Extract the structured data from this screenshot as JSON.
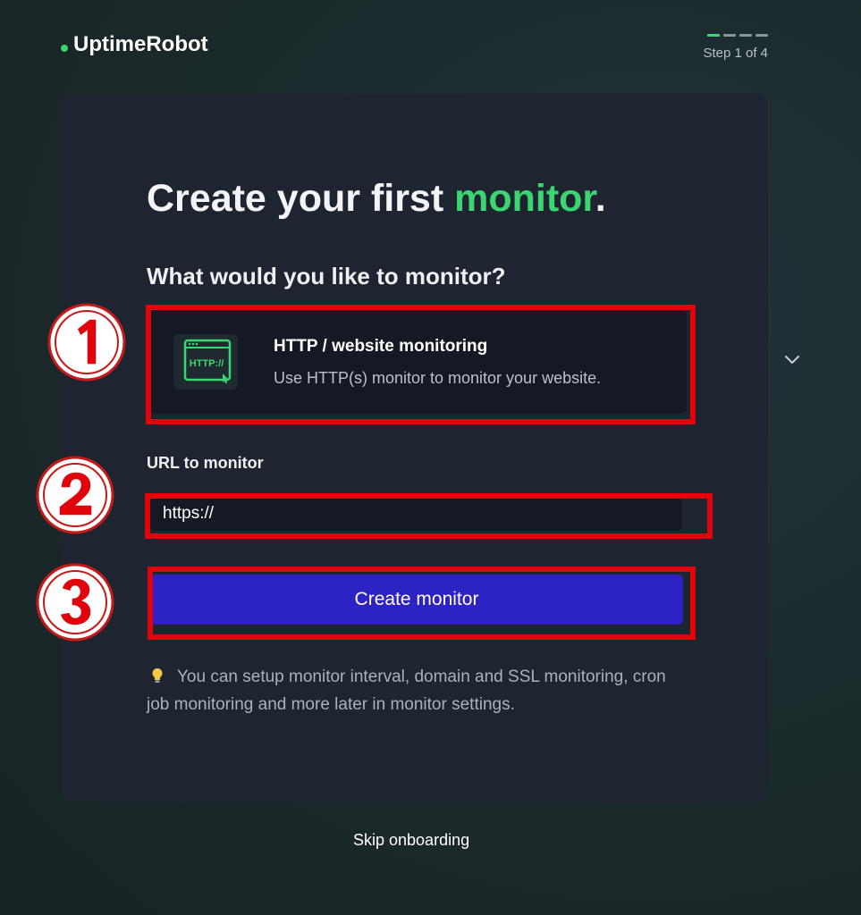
{
  "brand": {
    "name": "UptimeRobot",
    "accent_color": "#3bd671"
  },
  "stepper": {
    "label": "Step 1 of 4",
    "current": 1,
    "total": 4
  },
  "card": {
    "headline_prefix": "Create your first ",
    "headline_accent": "monitor",
    "headline_suffix": ".",
    "question": "What would you like to monitor?",
    "monitor_type": {
      "icon_text": "HTTP://",
      "title": "HTTP / website monitoring",
      "description": "Use HTTP(s) monitor to monitor your website."
    },
    "url_label": "URL to monitor",
    "url_value": "https://",
    "create_button": "Create monitor",
    "tip": "You can setup monitor interval, domain and SSL monitoring, cron job monitoring and more later in monitor settings."
  },
  "skip_link": "Skip onboarding",
  "annotations": {
    "marker_1": "①",
    "marker_2": "②",
    "marker_3": "③",
    "color": "#e0030b"
  }
}
